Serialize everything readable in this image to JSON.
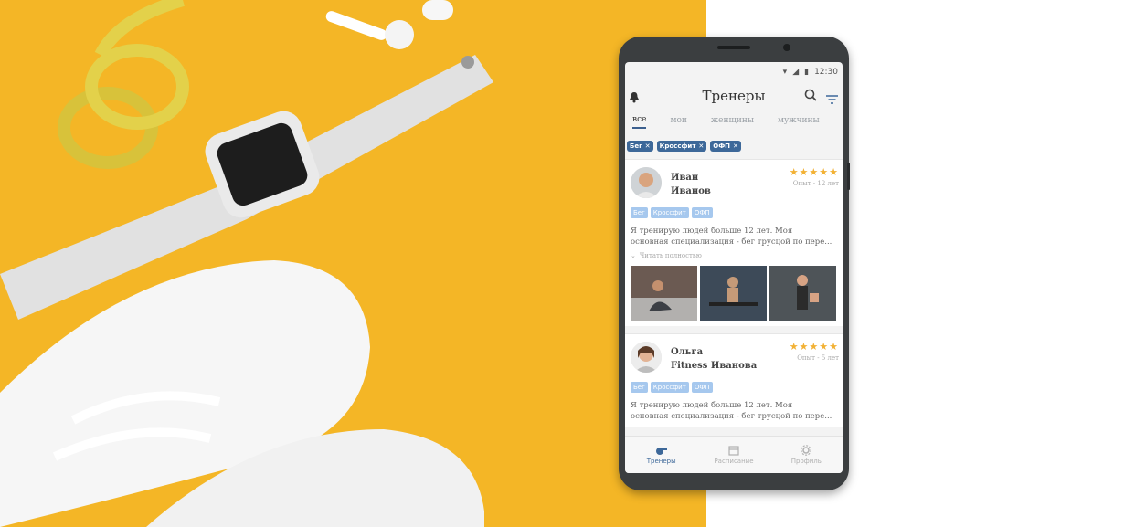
{
  "status": {
    "time": "12:30"
  },
  "header": {
    "title": "Тренеры"
  },
  "tabs": [
    {
      "label": "все"
    },
    {
      "label": "мои"
    },
    {
      "label": "женщины"
    },
    {
      "label": "мужчины"
    }
  ],
  "filters": [
    {
      "label": "Бег"
    },
    {
      "label": "Кроссфит"
    },
    {
      "label": "ОФП"
    }
  ],
  "trainers": [
    {
      "first": "Иван",
      "last": "Иванов",
      "rating": "★★★★★",
      "experience": "Опыт - 12 лет",
      "tags": [
        "Бег",
        "Кроссфит",
        "ОФП"
      ],
      "desc_line1": "Я тренирую людей больше 12 лет. Моя",
      "desc_line2": "основная специализация - бег трусцой по пере...",
      "more": "Читать полностью"
    },
    {
      "first": "Ольга",
      "last": "Fitness Иванова",
      "rating": "★★★★★",
      "experience": "Опыт - 5 лет",
      "tags": [
        "Бег",
        "Кроссфит",
        "ОФП"
      ],
      "desc_line1": "Я тренирую людей больше 12 лет. Моя",
      "desc_line2": "основная специализация - бег трусцой по пере..."
    }
  ],
  "bottom_nav": [
    {
      "label": "Тренеры"
    },
    {
      "label": "Расписание"
    },
    {
      "label": "Профиль"
    }
  ],
  "colors": {
    "accent": "#3d6899",
    "background": "#f4b626",
    "star": "#f2b134"
  }
}
